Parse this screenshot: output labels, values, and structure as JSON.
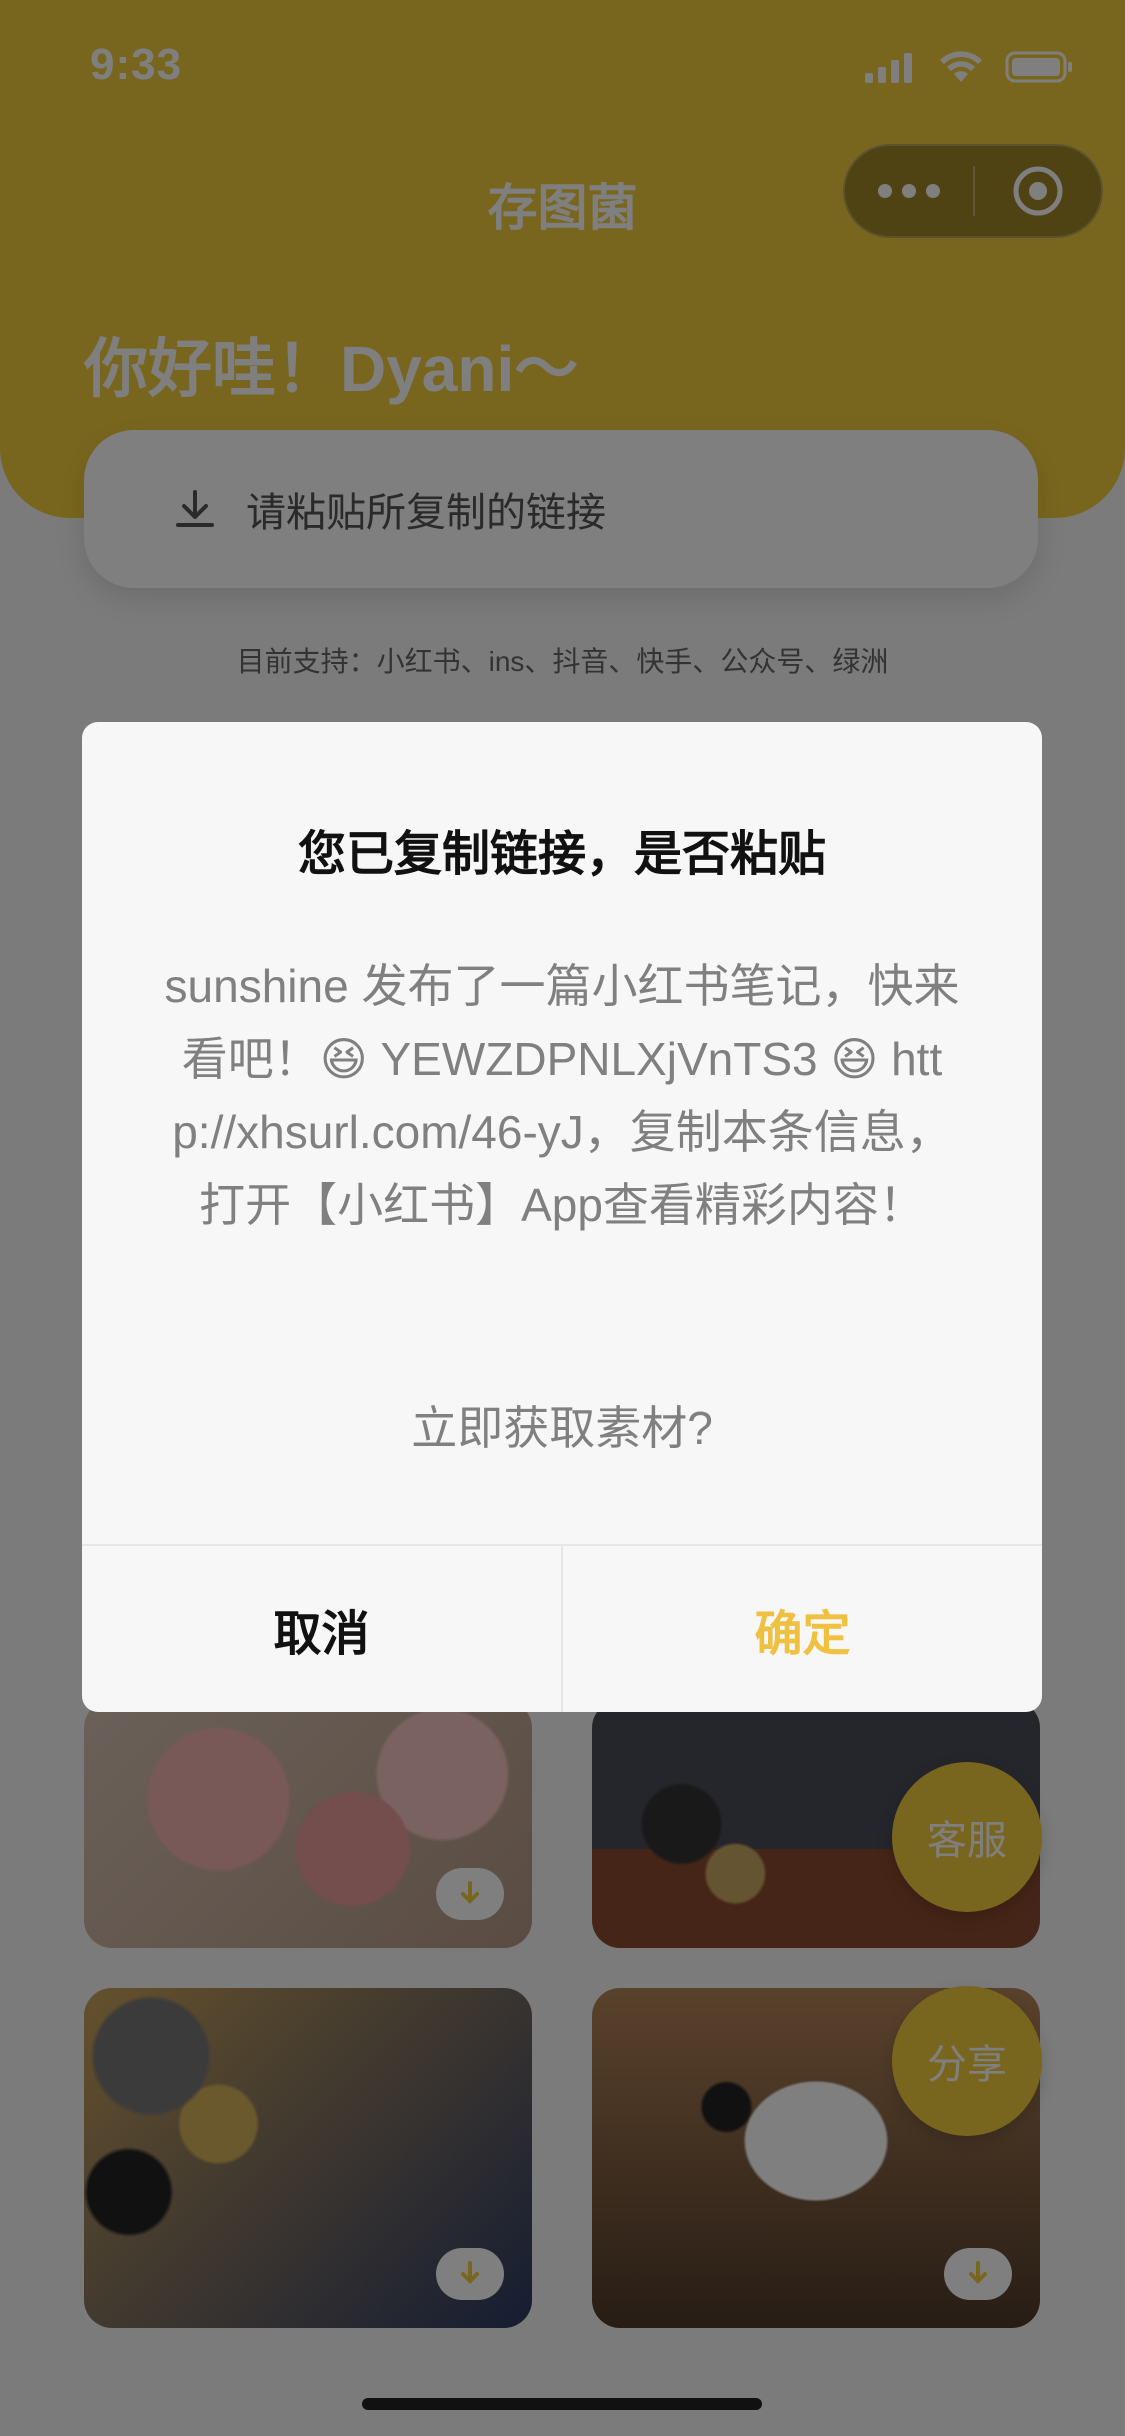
{
  "status_bar": {
    "time": "9:33"
  },
  "header": {
    "title": "存图菌",
    "greeting": "你好哇！Dyani～"
  },
  "paste": {
    "placeholder": "请粘贴所复制的链接"
  },
  "support_text": "目前支持：小红书、ins、抖音、快手、公众号、绿洲",
  "dialog": {
    "title": "您已复制链接，是否粘贴",
    "body": "sunshine 发布了一篇小红书笔记，快来看吧！😆 YEWZDPNLXjVnTS3 😆 http://xhsurl.com/46-yJ，复制本条信息，打开【小红书】App查看精彩内容！",
    "question": "立即获取素材?",
    "cancel": "取消",
    "confirm": "确定"
  },
  "fabs": {
    "service": "客服",
    "share": "分享"
  },
  "colors": {
    "accent": "#f3cd3c",
    "confirm": "#f0c040"
  }
}
